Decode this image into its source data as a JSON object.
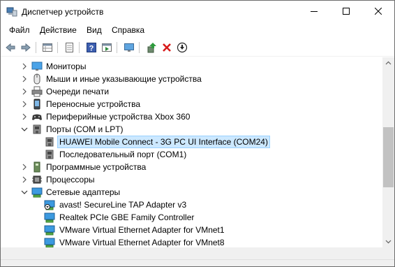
{
  "window": {
    "title": "Диспетчер устройств",
    "min_icon": "minimize-icon",
    "max_icon": "maximize-icon",
    "close_icon": "close-icon"
  },
  "menu": [
    "Файл",
    "Действие",
    "Вид",
    "Справка"
  ],
  "toolbar": [
    "back-arrow-icon",
    "forward-arrow-icon",
    "properties-grid-icon",
    "page-icon",
    "help-icon",
    "action-pane-icon",
    "computer-monitor-icon",
    "update-driver-icon",
    "uninstall-x-icon",
    "download-icon"
  ],
  "tree": [
    {
      "label": "Мониторы",
      "expanded": false,
      "level": 1,
      "icon": "monitor-icon"
    },
    {
      "label": "Мыши и иные указывающие устройства",
      "expanded": false,
      "level": 1,
      "icon": "mouse-icon"
    },
    {
      "label": "Очереди печати",
      "expanded": false,
      "level": 1,
      "icon": "printer-icon"
    },
    {
      "label": "Переносные устройства",
      "expanded": false,
      "level": 1,
      "icon": "portable-device-icon"
    },
    {
      "label": "Периферийные устройства Xbox 360",
      "expanded": false,
      "level": 1,
      "icon": "gamepad-icon"
    },
    {
      "label": "Порты (COM и LPT)",
      "expanded": true,
      "level": 1,
      "icon": "port-icon"
    },
    {
      "label": "HUAWEI Mobile Connect - 3G PC UI Interface (COM24)",
      "level": 2,
      "icon": "port-icon",
      "selected": true
    },
    {
      "label": "Последовательный порт (COM1)",
      "level": 2,
      "icon": "port-icon"
    },
    {
      "label": "Программные устройства",
      "expanded": false,
      "level": 1,
      "icon": "software-device-icon"
    },
    {
      "label": "Процессоры",
      "expanded": false,
      "level": 1,
      "icon": "processor-icon"
    },
    {
      "label": "Сетевые адаптеры",
      "expanded": true,
      "level": 1,
      "icon": "network-adapter-icon"
    },
    {
      "label": "avast! SecureLine TAP Adapter v3",
      "level": 2,
      "icon": "network-adapter-disabled-icon"
    },
    {
      "label": "Realtek PCIe GBE Family Controller",
      "level": 2,
      "icon": "network-adapter-icon"
    },
    {
      "label": "VMware Virtual Ethernet Adapter for VMnet1",
      "level": 2,
      "icon": "network-adapter-icon"
    },
    {
      "label": "VMware Virtual Ethernet Adapter for VMnet8",
      "level": 2,
      "icon": "network-adapter-icon"
    }
  ]
}
